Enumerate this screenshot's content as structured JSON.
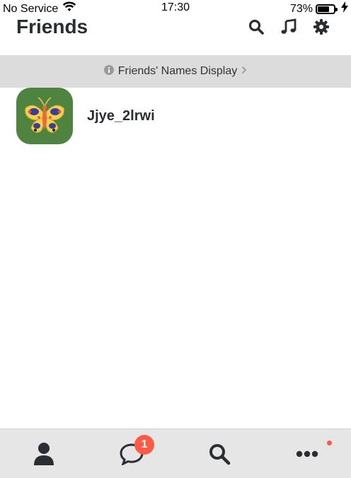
{
  "status_bar": {
    "carrier": "No Service",
    "time": "17:30",
    "battery_percent": "73%",
    "battery_level": 0.73
  },
  "header": {
    "title": "Friends",
    "icons": [
      "search-icon",
      "music-note-icon",
      "gear-icon"
    ]
  },
  "banner": {
    "label": "Friends' Names Display",
    "icon": "info-icon"
  },
  "friends": [
    {
      "name": "Jjye_2lrwi",
      "avatar_icon": "butterfly-icon"
    }
  ],
  "tab_bar": {
    "tabs": [
      "person-icon",
      "chat-bubble-icon",
      "search-icon",
      "more-icon"
    ],
    "chat_badge": "1"
  },
  "colors": {
    "accent_badge": "#ff5a45",
    "avatar_bg": "#4e8440",
    "banner_bg": "#dcdcdc",
    "tab_bar_bg": "#e6e6e6"
  }
}
